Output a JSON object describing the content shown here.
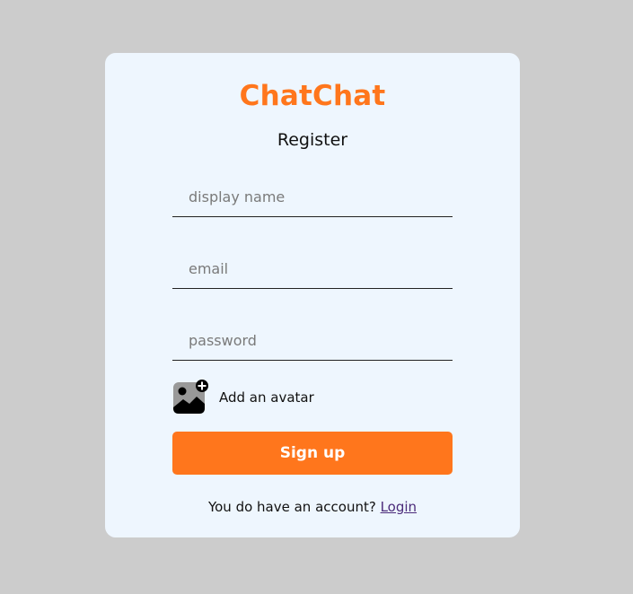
{
  "app": {
    "logo": "ChatChat",
    "subtitle": "Register"
  },
  "colors": {
    "brand": "#ff761c",
    "page_background": "#cccccc",
    "card_background": "#eef6fe",
    "link": "#4b2b7a"
  },
  "form": {
    "display_name_placeholder": "display name",
    "display_name_value": "",
    "email_placeholder": "email",
    "email_value": "",
    "password_placeholder": "password",
    "password_value": "",
    "avatar_label": "Add an avatar",
    "avatar_icon": "add-image-icon",
    "submit_label": "Sign up"
  },
  "footer": {
    "prompt": "You do have an account? ",
    "login_link": "Login"
  }
}
